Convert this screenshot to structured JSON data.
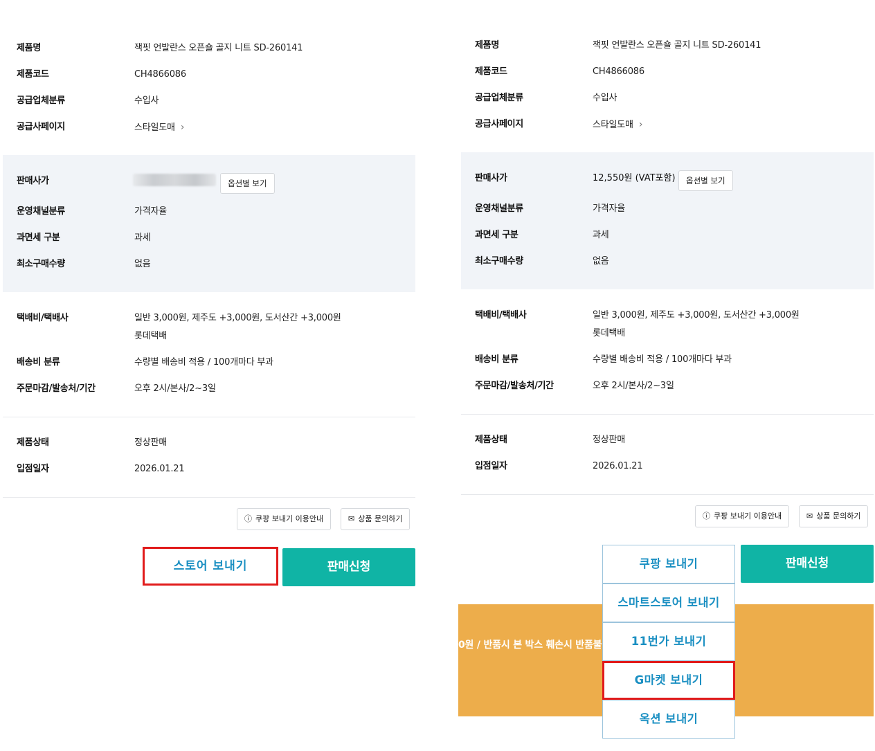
{
  "left": {
    "product_name_label": "제품명",
    "product_name": "잭핏 언발란스 오픈숄 골지 니트 SD-260141",
    "product_code_label": "제품코드",
    "product_code": "CH4866086",
    "supplier_type_label": "공급업체분류",
    "supplier_type": "수입사",
    "supplier_page_label": "공급사페이지",
    "supplier_page": "스타일도매",
    "sale_price_label": "판매사가",
    "option_price_button": "옵션별 보기",
    "channel_label": "운영채널분류",
    "channel": "가격자율",
    "tax_label": "과면세 구분",
    "tax": "과세",
    "min_qty_label": "최소구매수량",
    "min_qty": "없음",
    "shipping_label": "택배비/택배사",
    "shipping_fee": "일반 3,000원, 제주도 +3,000원, 도서산간 +3,000원",
    "courier": "롯데택배",
    "shipping_type_label": "배송비 분류",
    "shipping_type": "수량별 배송비 적용 / 100개마다 부과",
    "order_label": "주문마감/발송처/기간",
    "order": "오후 2시/본사/2~3일",
    "status_label": "제품상태",
    "status": "정상판매",
    "date_label": "입점일자",
    "date": "2026.01.21",
    "coupang_guide_button": "쿠팡 보내기 이용안내",
    "inquiry_button": "상품 문의하기",
    "store_send_button": "스토어 보내기",
    "apply_sale_button": "판매신청"
  },
  "right": {
    "product_name_label": "제품명",
    "product_name": "잭핏 언발란스 오픈숄 골지 니트 SD-260141",
    "product_code_label": "제품코드",
    "product_code": "CH4866086",
    "supplier_type_label": "공급업체분류",
    "supplier_type": "수입사",
    "supplier_page_label": "공급사페이지",
    "supplier_page": "스타일도매",
    "sale_price_label": "판매사가",
    "sale_price": "12,550원 (VAT포함)",
    "option_price_button": "옵션별 보기",
    "channel_label": "운영채널분류",
    "channel": "가격자율",
    "tax_label": "과면세 구분",
    "tax": "과세",
    "min_qty_label": "최소구매수량",
    "min_qty": "없음",
    "shipping_label": "택배비/택배사",
    "shipping_fee": "일반 3,000원, 제주도 +3,000원, 도서산간 +3,000원",
    "courier": "롯데택배",
    "shipping_type_label": "배송비 분류",
    "shipping_type": "수량별 배송비 적용 / 100개마다 부과",
    "order_label": "주문마감/발송처/기간",
    "order": "오후 2시/본사/2~3일",
    "status_label": "제품상태",
    "status": "정상판매",
    "date_label": "입점일자",
    "date": "2026.01.21",
    "coupang_guide_button": "쿠팡 보내기 이용안내",
    "inquiry_button": "상품 문의하기",
    "apply_sale_button": "판매신청",
    "banner_text": "0원 / 반품시 본 박스 훼손시 반품불",
    "send_menu": [
      "쿠팡 보내기",
      "스마트스토어 보내기",
      "11번가 보내기",
      "G마켓 보내기",
      "옥션 보내기"
    ],
    "selected_menu": "G마켓 보내기"
  },
  "colors": {
    "accent_teal": "#10b4a5",
    "link_blue": "#1a8fc2",
    "highlight_red": "#e11b1b",
    "banner_orange": "#edad4b",
    "gray_panel": "#f1f4f8"
  },
  "icons": {
    "chevron": "chevron-right-icon",
    "help": "question-circle-icon",
    "mail": "mail-icon"
  }
}
